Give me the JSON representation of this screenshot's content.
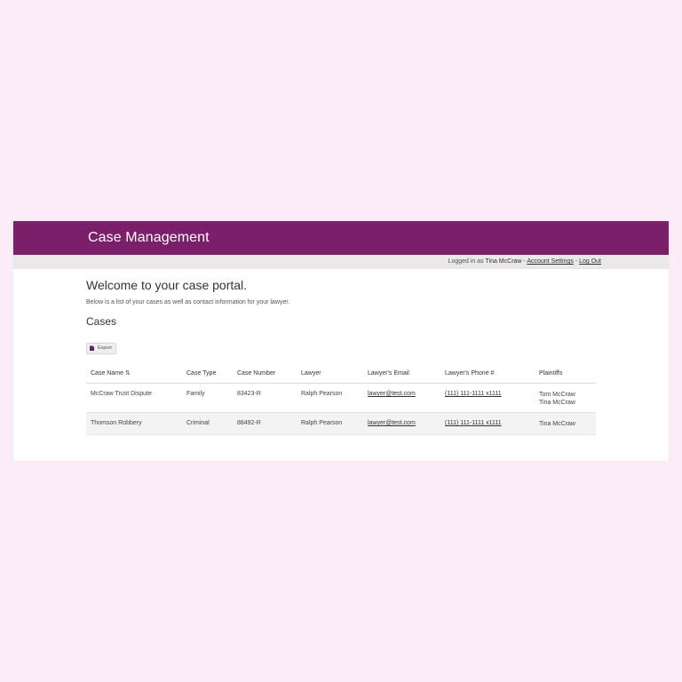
{
  "header": {
    "title": "Case Management"
  },
  "userbar": {
    "prefix": "Logged in as ",
    "user": "Tina McCraw",
    "sep1": " - ",
    "account_settings": "Account Settings",
    "sep2": " - ",
    "logout": "Log Out"
  },
  "main": {
    "welcome": "Welcome to your case portal.",
    "subtitle": "Below is a list of your cases as well as contact information for your lawyer.",
    "cases_heading": "Cases",
    "export_label": "Export"
  },
  "table": {
    "columns": [
      "Case Name",
      "Case Type",
      "Case Number",
      "Lawyer",
      "Lawyer's Email",
      "Lawyer's Phone #",
      "Plaintiffs"
    ],
    "rows": [
      {
        "case_name": "McCraw Trust Dispute",
        "case_type": "Family",
        "case_number": "83423-R",
        "lawyer": "Ralph Pearson",
        "email": "lawyer@test.com",
        "phone": "(111) 111-1111 x1111",
        "plaintiffs": [
          "Tom McCraw",
          "Tina McCraw"
        ]
      },
      {
        "case_name": "Thomson Robbery",
        "case_type": "Criminal",
        "case_number": "88492-R",
        "lawyer": "Ralph Pearson",
        "email": "lawyer@test.com",
        "phone": "(111) 111-1111 x1111",
        "plaintiffs": [
          "Tina McCraw"
        ]
      }
    ]
  },
  "colors": {
    "brand": "#7b1f6b",
    "background": "#fbecf8"
  },
  "icons": {
    "sort": "sort-icon",
    "export": "document-icon"
  }
}
